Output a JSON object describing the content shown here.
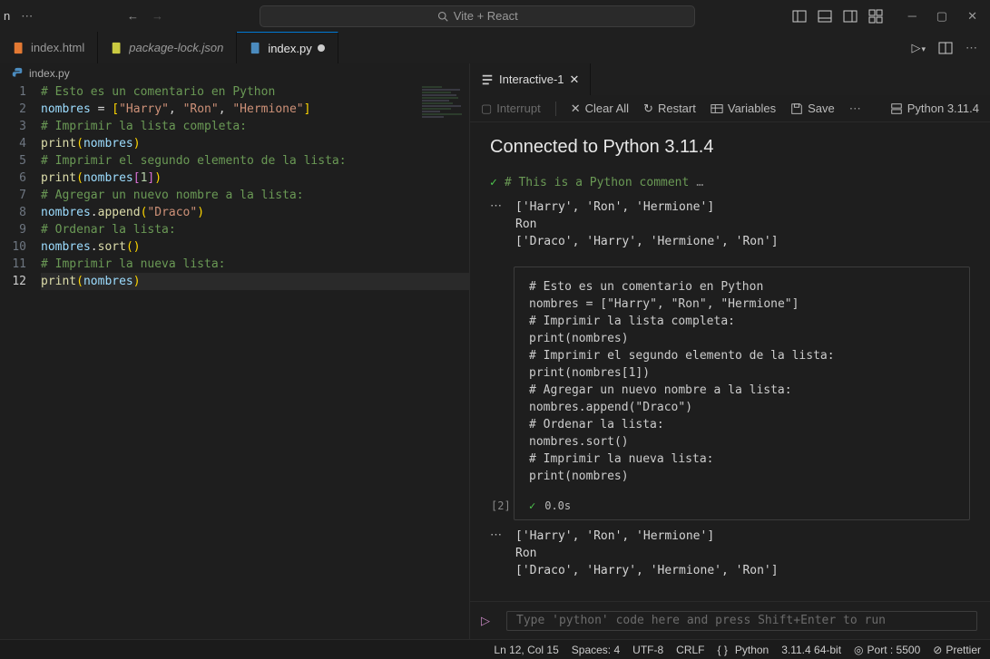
{
  "titlebar": {
    "app_label": "n",
    "search_label": "Vite + React"
  },
  "tabs": [
    {
      "icon": "html-icon",
      "label": "index.html",
      "icon_color": "#e37933"
    },
    {
      "icon": "json-icon",
      "label": "package-lock.json",
      "italic": true,
      "icon_color": "#cbcb41"
    },
    {
      "icon": "python-icon",
      "label": "index.py",
      "active": true,
      "dirty": true,
      "icon_color": "#4b8bbe"
    }
  ],
  "breadcrumb": {
    "icon_color": "#4b8bbe",
    "label": "index.py"
  },
  "editor": {
    "lines": [
      {
        "n": 1,
        "t": "comment",
        "text": "# Esto es un comentario en Python"
      },
      {
        "n": 2,
        "tokens": [
          [
            "ident",
            "nombres"
          ],
          [
            "br",
            " = "
          ],
          [
            "br-y",
            "["
          ],
          [
            "str",
            "\"Harry\""
          ],
          [
            "br",
            ", "
          ],
          [
            "str",
            "\"Ron\""
          ],
          [
            "br",
            ", "
          ],
          [
            "str",
            "\"Hermione\""
          ],
          [
            "br-y",
            "]"
          ]
        ]
      },
      {
        "n": 3,
        "t": "comment",
        "text": "# Imprimir la lista completa:"
      },
      {
        "n": 4,
        "tokens": [
          [
            "fn",
            "print"
          ],
          [
            "br-y",
            "("
          ],
          [
            "ident",
            "nombres"
          ],
          [
            "br-y",
            ")"
          ]
        ]
      },
      {
        "n": 5,
        "t": "comment",
        "text": "# Imprimir el segundo elemento de la lista:"
      },
      {
        "n": 6,
        "tokens": [
          [
            "fn",
            "print"
          ],
          [
            "br-y",
            "("
          ],
          [
            "ident",
            "nombres"
          ],
          [
            "br-p",
            "["
          ],
          [
            "num",
            "1"
          ],
          [
            "br-p",
            "]"
          ],
          [
            "br-y",
            ")"
          ]
        ]
      },
      {
        "n": 7,
        "t": "comment",
        "text": "# Agregar un nuevo nombre a la lista:"
      },
      {
        "n": 8,
        "tokens": [
          [
            "ident",
            "nombres"
          ],
          [
            "br",
            "."
          ],
          [
            "fn",
            "append"
          ],
          [
            "br-y",
            "("
          ],
          [
            "str",
            "\"Draco\""
          ],
          [
            "br-y",
            ")"
          ]
        ]
      },
      {
        "n": 9,
        "t": "comment",
        "text": "# Ordenar la lista:"
      },
      {
        "n": 10,
        "tokens": [
          [
            "ident",
            "nombres"
          ],
          [
            "br",
            "."
          ],
          [
            "fn",
            "sort"
          ],
          [
            "br-y",
            "("
          ],
          [
            "br-y",
            ")"
          ]
        ]
      },
      {
        "n": 11,
        "t": "comment",
        "text": "# Imprimir la nueva lista:"
      },
      {
        "n": 12,
        "hl": true,
        "tokens": [
          [
            "fn",
            "print"
          ],
          [
            "br-y",
            "("
          ],
          [
            "ident",
            "nombres"
          ],
          [
            "br-y",
            ")"
          ]
        ]
      }
    ]
  },
  "panel": {
    "tab_label": "Interactive-1",
    "toolbar": {
      "interrupt": "Interrupt",
      "clear": "Clear All",
      "restart": "Restart",
      "variables": "Variables",
      "save": "Save",
      "interpreter": "Python 3.11.4"
    },
    "heading": "Connected to Python 3.11.4",
    "first_run_label": "# This is a Python comment",
    "first_run_ellipsis": "…",
    "output1": [
      "['Harry', 'Ron', 'Hermione']",
      "Ron",
      "['Draco', 'Harry', 'Hermione', 'Ron']"
    ],
    "cell_code": [
      {
        "t": "comment",
        "text": "# Esto es un comentario en Python"
      },
      {
        "tokens": [
          [
            "ident",
            "nombres"
          ],
          [
            "br",
            " = "
          ],
          [
            "br-y",
            "["
          ],
          [
            "str",
            "\"Harry\""
          ],
          [
            "br",
            ", "
          ],
          [
            "str",
            "\"Ron\""
          ],
          [
            "br",
            ", "
          ],
          [
            "str",
            "\"Hermione\""
          ],
          [
            "br-y",
            "]"
          ]
        ]
      },
      {
        "t": "comment",
        "text": "# Imprimir la lista completa:"
      },
      {
        "tokens": [
          [
            "fn",
            "print"
          ],
          [
            "br-y",
            "("
          ],
          [
            "ident",
            "nombres"
          ],
          [
            "br-y",
            ")"
          ]
        ]
      },
      {
        "t": "comment",
        "text": "# Imprimir el segundo elemento de la lista:"
      },
      {
        "tokens": [
          [
            "fn",
            "print"
          ],
          [
            "br-y",
            "("
          ],
          [
            "ident",
            "nombres"
          ],
          [
            "br-p",
            "["
          ],
          [
            "num",
            "1"
          ],
          [
            "br-p",
            "]"
          ],
          [
            "br-y",
            ")"
          ]
        ]
      },
      {
        "t": "comment",
        "text": "# Agregar un nuevo nombre a la lista:"
      },
      {
        "tokens": [
          [
            "ident",
            "nombres"
          ],
          [
            "br",
            "."
          ],
          [
            "fn",
            "append"
          ],
          [
            "br-y",
            "("
          ],
          [
            "str",
            "\"Draco\""
          ],
          [
            "br-y",
            ")"
          ]
        ]
      },
      {
        "t": "comment",
        "text": "# Ordenar la lista:"
      },
      {
        "tokens": [
          [
            "ident",
            "nombres"
          ],
          [
            "br",
            "."
          ],
          [
            "fn",
            "sort"
          ],
          [
            "br-y",
            "("
          ],
          [
            "br-y",
            ")"
          ]
        ]
      },
      {
        "t": "comment",
        "text": "# Imprimir la nueva lista:"
      },
      {
        "tokens": [
          [
            "fn",
            "print"
          ],
          [
            "br-y",
            "("
          ],
          [
            "ident",
            "nombres"
          ],
          [
            "br-y",
            ")"
          ]
        ]
      }
    ],
    "cell_index": "[2]",
    "cell_time": "0.0s",
    "output2": [
      "['Harry', 'Ron', 'Hermione']",
      "Ron",
      "['Draco', 'Harry', 'Hermione', 'Ron']"
    ],
    "repl_placeholder": "Type 'python' code here and press Shift+Enter to run"
  },
  "statusbar": {
    "position": "Ln 12, Col 15",
    "spaces": "Spaces: 4",
    "encoding": "UTF-8",
    "eol": "CRLF",
    "lang": "Python",
    "interpreter": "3.11.4 64-bit",
    "port": "Port : 5500",
    "prettier": "Prettier"
  }
}
